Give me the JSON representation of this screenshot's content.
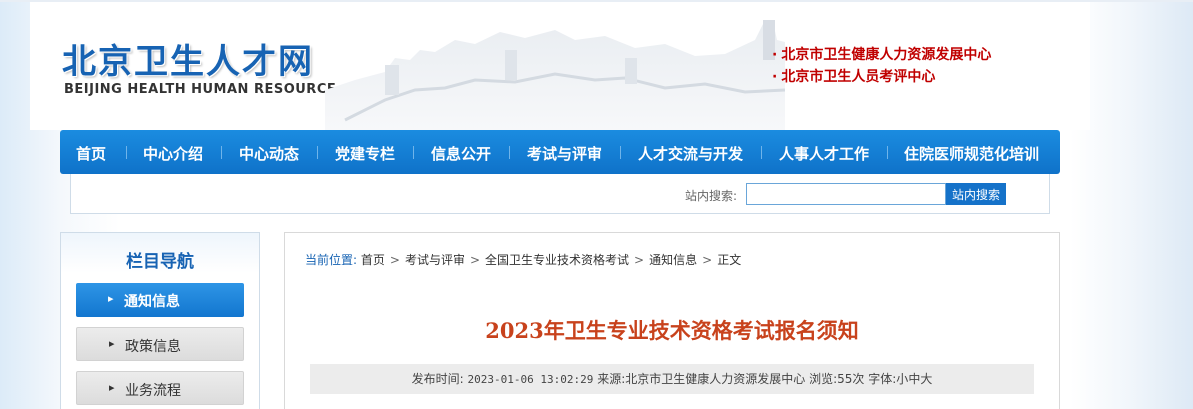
{
  "header": {
    "logo_cn": "北京卫生人才网",
    "logo_en": "BEIJING HEALTH HUMAN RESOURCE",
    "org_links": [
      {
        "label": "北京市卫生健康人力资源发展中心"
      },
      {
        "label": "北京市卫生人员考评中心"
      }
    ]
  },
  "nav": {
    "items": [
      {
        "label": "首页"
      },
      {
        "label": "中心介绍"
      },
      {
        "label": "中心动态"
      },
      {
        "label": "党建专栏"
      },
      {
        "label": "信息公开"
      },
      {
        "label": "考试与评审"
      },
      {
        "label": "人才交流与开发"
      },
      {
        "label": "人事人才工作"
      },
      {
        "label": "住院医师规范化培训"
      }
    ]
  },
  "search": {
    "label": "站内搜索:",
    "value": "",
    "button": "站内搜索"
  },
  "sidebar": {
    "title": "栏目导航",
    "items": [
      {
        "label": "通知信息"
      },
      {
        "label": "政策信息"
      },
      {
        "label": "业务流程"
      }
    ]
  },
  "breadcrumb": {
    "prefix": "当前位置:",
    "items": [
      {
        "label": "首页"
      },
      {
        "label": "考试与评审"
      },
      {
        "label": "全国卫生专业技术资格考试"
      },
      {
        "label": "通知信息"
      },
      {
        "label": "正文"
      }
    ]
  },
  "article": {
    "title": "2023年卫生专业技术资格考试报名须知",
    "meta_publish_label": "发布时间:",
    "meta_publish_value": "2023-01-06 13:02:29",
    "meta_source_label": "来源:",
    "meta_source_value": "北京市卫生健康人力资源发展中心",
    "meta_views_label": "浏览:",
    "meta_views_value": "55次",
    "meta_font_label": "字体:",
    "font_sizes": [
      "小",
      "中",
      "大"
    ]
  },
  "colors": {
    "brand_blue": "#1763b3",
    "nav_blue": "#1480d8",
    "accent_red": "#c00000",
    "title_orange": "#c8421c"
  }
}
